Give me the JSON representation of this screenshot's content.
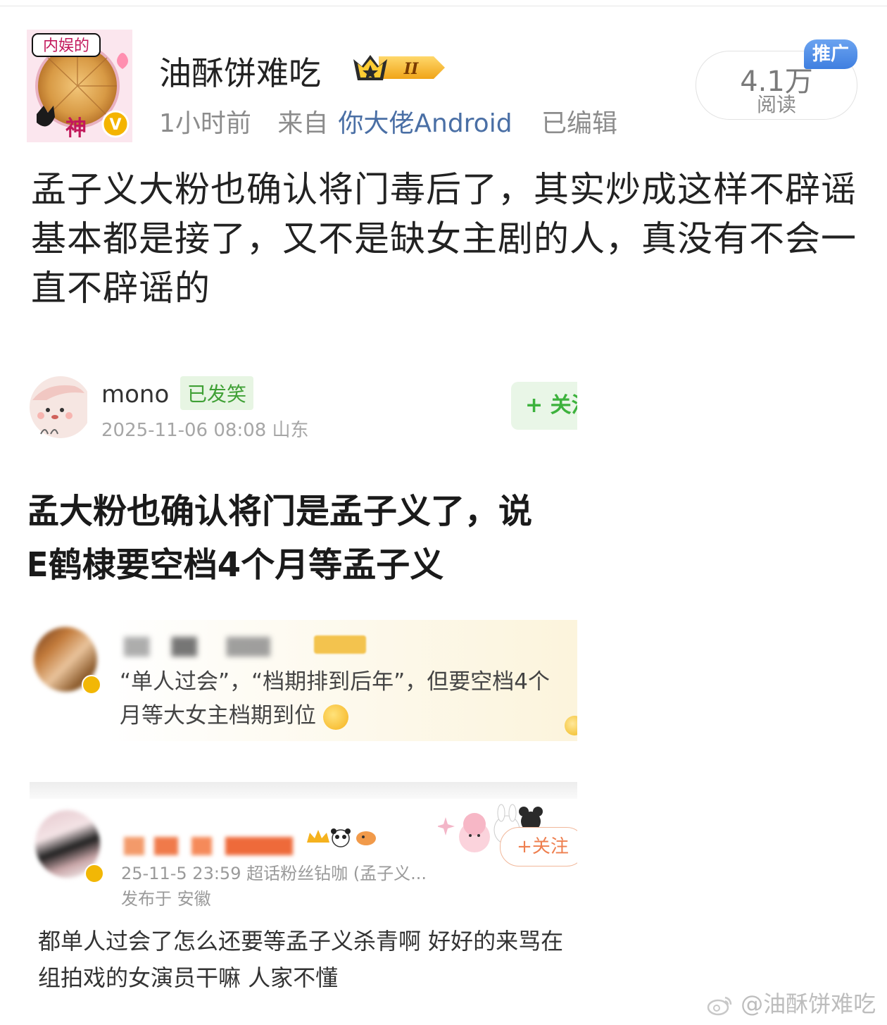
{
  "header": {
    "username": "油酥饼难吃",
    "level_badge": "II",
    "time": "1小时前",
    "from_label": "来自",
    "source": "你大佬Android",
    "edited": "已编辑",
    "avatar_sticker_top": "内娱的",
    "avatar_sticker_bottom": "神",
    "reads_count": "4.1万",
    "reads_label": "阅读",
    "promo_tag": "推广"
  },
  "post": {
    "text": "孟子义大粉也确认将门毒后了，其实炒成这样不辟谣基本都是接了，又不是缺女主剧的人，真没有不会一直不辟谣的"
  },
  "embedded": {
    "first": {
      "name": "mono",
      "badge": "已发笑",
      "time": "2025-11-06 08:08  山东",
      "follow": "+ 关注",
      "line1": "孟大粉也确认将门是孟子义了，说",
      "line2": "E鹤棣要空档4个月等孟子义"
    },
    "second": {
      "quote": "“单人过会”，“档期排到后年”，但要空档4个月等大女主档期到位"
    },
    "third": {
      "time": "25-11-5 23:59  超话粉丝钻咖 (孟子义...",
      "location": "发布于 安徽",
      "follow": "+关注",
      "comment": "都单人过会了怎么还要等孟子义杀青啊 好好的来骂在组拍戏的女演员干嘛 人家不懂"
    }
  },
  "watermark": "@油酥饼难吃",
  "colors": {
    "link": "#4a6fa5",
    "promo": "#3f7fe0",
    "green_badge": "#3fa035",
    "orange_follow": "#ee7f4f"
  }
}
